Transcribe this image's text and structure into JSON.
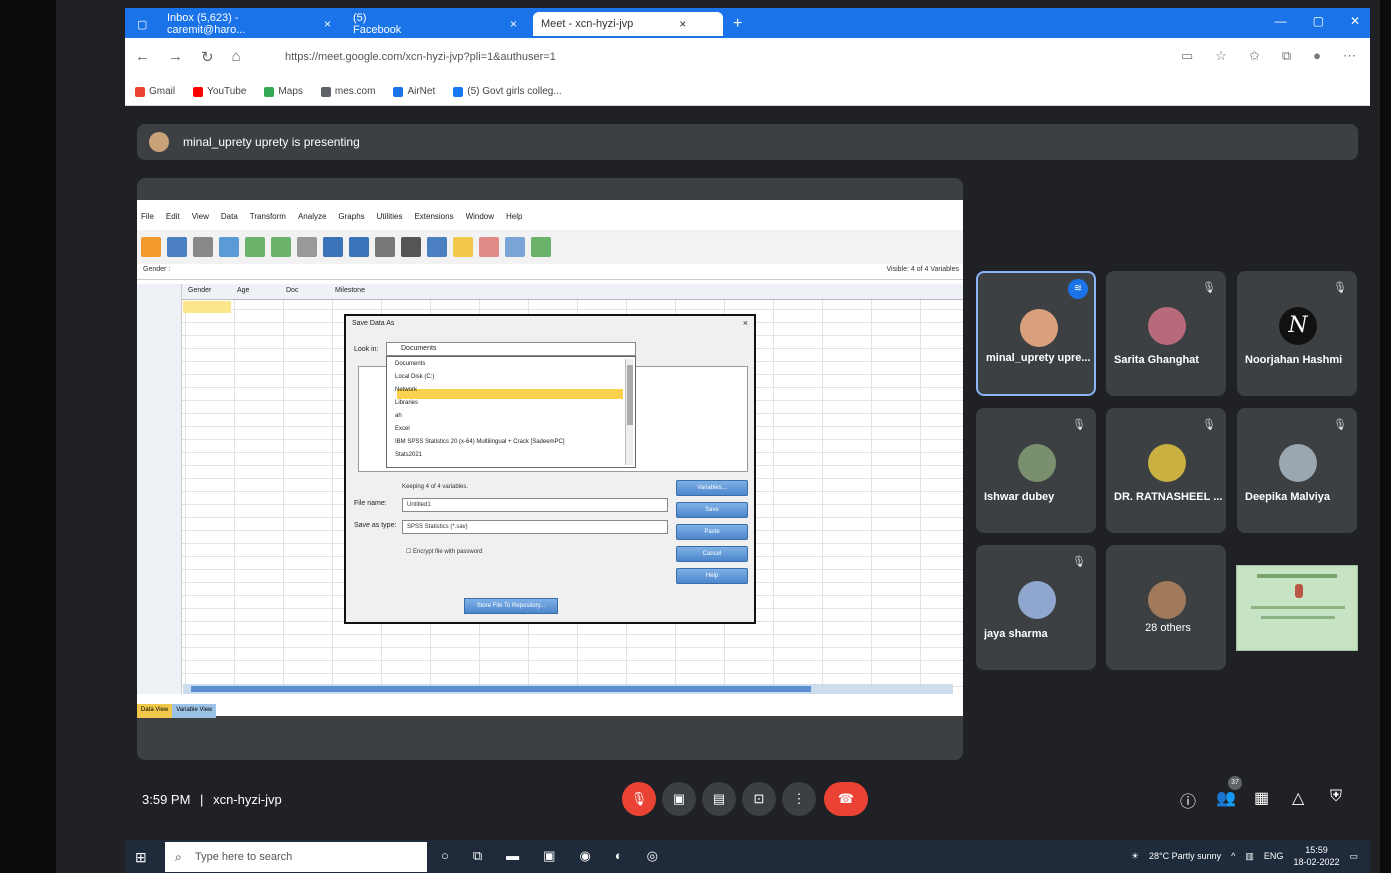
{
  "browser": {
    "tabs": [
      {
        "label": "Inbox (5,623) - caremit@haro..."
      },
      {
        "label": "(5) Facebook"
      },
      {
        "label": "Meet - xcn-hyzi-jvp"
      }
    ],
    "url": "https://meet.google.com/xcn-hyzi-jvp?pli=1&authuser=1",
    "bookmarks": [
      {
        "label": "Gmail",
        "color": "#ea4335"
      },
      {
        "label": "YouTube",
        "color": "#ff0000"
      },
      {
        "label": "Maps",
        "color": "#34a853"
      },
      {
        "label": "mes.com",
        "color": "#5f6368"
      },
      {
        "label": "AirNet",
        "color": "#1a73e8"
      },
      {
        "label": "(5) Govt girls colleg...",
        "color": "#1877f2"
      }
    ]
  },
  "meet": {
    "presenting_text": "minal_uprety uprety is presenting",
    "meeting_time": "3:59 PM",
    "separator": "|",
    "meeting_code": "xcn-hyzi-jvp",
    "participants_count": "37",
    "participants": [
      {
        "name": "minal_uprety upre...",
        "speaking": true,
        "color": "#d9a07d"
      },
      {
        "name": "Sarita Ghanghat",
        "speaking": false,
        "color": "#b86a7a"
      },
      {
        "name": "Noorjahan Hashmi",
        "speaking": false,
        "monogram": "N"
      },
      {
        "name": "Ishwar dubey",
        "speaking": false,
        "color": "#7a8f6e"
      },
      {
        "name": "DR. RATNASHEEL ...",
        "speaking": false,
        "color": "#c9b040"
      },
      {
        "name": "Deepika Malviya",
        "speaking": false,
        "color": "#9aa7b0"
      },
      {
        "name": "jaya sharma",
        "speaking": false,
        "color": "#8fa7cf"
      }
    ],
    "others_label": "28 others"
  },
  "spss": {
    "menu": [
      "File",
      "Edit",
      "View",
      "Data",
      "Transform",
      "Analyze",
      "Graphs",
      "Utilities",
      "Extensions",
      "Window",
      "Help"
    ],
    "cell_ref": "Gender :",
    "visible_vars": "Visible: 4 of 4 Variables",
    "columns": [
      "Gender",
      "Age",
      "Doc",
      "Milestone"
    ],
    "view_tabs": [
      "Data View",
      "Variable View"
    ]
  },
  "dialog": {
    "title": "Save Data As",
    "look_in_label": "Look in:",
    "look_in_value": "Documents",
    "dropdown_items": [
      "Documents",
      "Local Disk (C:)",
      "Network",
      "Libraries",
      "ah",
      "Excel",
      "IBM SPSS Statistics 20 (x-64) Multilingual + Crack [SadeemPC]",
      "Stats2021"
    ],
    "keeping_text": "Keeping 4 of 4 variables.",
    "filename_label": "File name:",
    "filename_value": "Untitled1",
    "saveas_label": "Save as type:",
    "saveas_value": "SPSS Statistics (*.sav)",
    "encrypt_label": "Encrypt file with password",
    "buttons": [
      "Variables...",
      "Save",
      "Paste",
      "Cancel",
      "Help"
    ],
    "repository_button": "Store File To Repository..."
  },
  "taskbar": {
    "search_placeholder": "Type here to search",
    "weather": "28°C Partly sunny",
    "lang": "ENG",
    "time": "15:59",
    "date": "18-02-2022"
  }
}
